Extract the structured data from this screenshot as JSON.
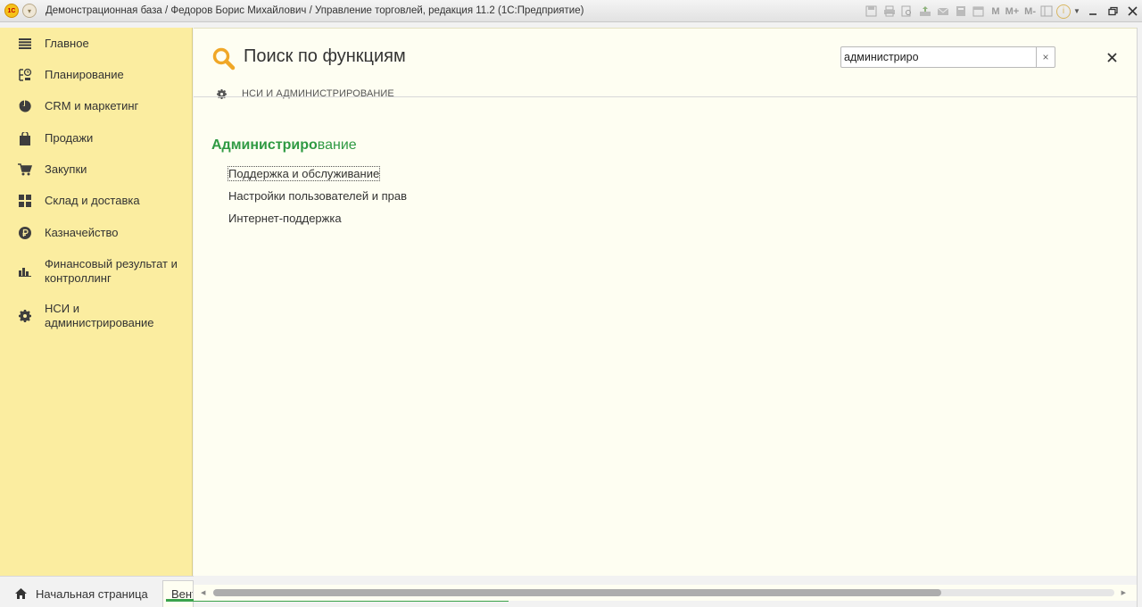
{
  "window": {
    "title": "Демонстрационная база / Федоров Борис Михайлович / Управление торговлей, редакция 11.2  (1С:Предприятие)",
    "logo_text": "1С",
    "tools": {
      "m": "M",
      "m_plus": "M+",
      "m_minus": "M-",
      "info": "i"
    }
  },
  "sidebar": {
    "items": [
      {
        "label": "Главное",
        "icon": "menu-icon"
      },
      {
        "label": "Планирование",
        "icon": "planning-icon"
      },
      {
        "label": "CRM и маркетинг",
        "icon": "pie-chart-icon"
      },
      {
        "label": "Продажи",
        "icon": "shopping-bag-icon"
      },
      {
        "label": "Закупки",
        "icon": "cart-icon"
      },
      {
        "label": "Склад и доставка",
        "icon": "warehouse-grid-icon"
      },
      {
        "label": "Казначейство",
        "icon": "ruble-coin-icon"
      },
      {
        "label": "Финансовый результат и контроллинг",
        "icon": "bar-chart-icon"
      },
      {
        "label": "НСИ и администрирование",
        "icon": "gear-icon"
      }
    ]
  },
  "main": {
    "title": "Поиск по функциям",
    "search": {
      "value": "администриро",
      "clear_label": "×"
    },
    "close_label": "✕",
    "section": {
      "label": "НСИ И АДМИНИСТРИРОВАНИЕ"
    },
    "result": {
      "title_match": "Администриро",
      "title_rest": "вание",
      "links": [
        "Поддержка и обслуживание",
        "Настройки пользователей и прав",
        "Интернет-поддержка"
      ]
    }
  },
  "bottom": {
    "home_label": "Начальная страница",
    "open_tab_label": "Вентаж"
  },
  "colors": {
    "sidebar_bg": "#fbeda0",
    "main_bg": "#fefef2",
    "accent_green": "#2f9a43",
    "search_icon": "#f0a727"
  }
}
